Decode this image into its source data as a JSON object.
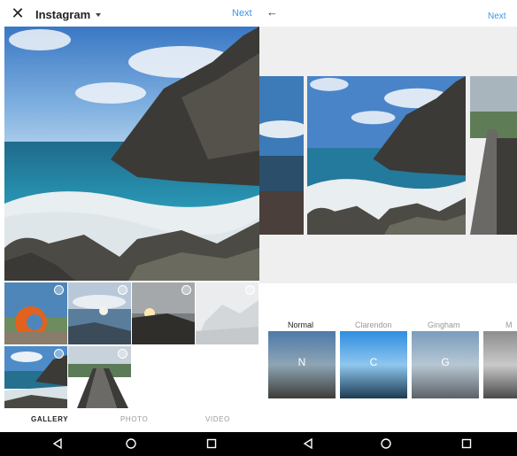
{
  "left": {
    "title": "Instagram",
    "next_label": "Next",
    "close_icon": "close-icon",
    "tabs": [
      {
        "label": "GALLERY",
        "active": true
      },
      {
        "label": "PHOTO",
        "active": false
      },
      {
        "label": "VIDEO",
        "active": false
      }
    ]
  },
  "right": {
    "next_label": "Next",
    "back_icon": "arrow-back-icon",
    "filters": [
      {
        "label": "Normal",
        "letter": "N",
        "selected": true
      },
      {
        "label": "Clarendon",
        "letter": "C",
        "selected": false
      },
      {
        "label": "Gingham",
        "letter": "G",
        "selected": false
      },
      {
        "label": "M",
        "letter": "",
        "selected": false
      }
    ]
  },
  "colors": {
    "accent": "#3897f0",
    "navbar": "#000000"
  },
  "navbar": {
    "icons": [
      "back-triangle-icon",
      "home-circle-icon",
      "recents-square-icon"
    ]
  }
}
